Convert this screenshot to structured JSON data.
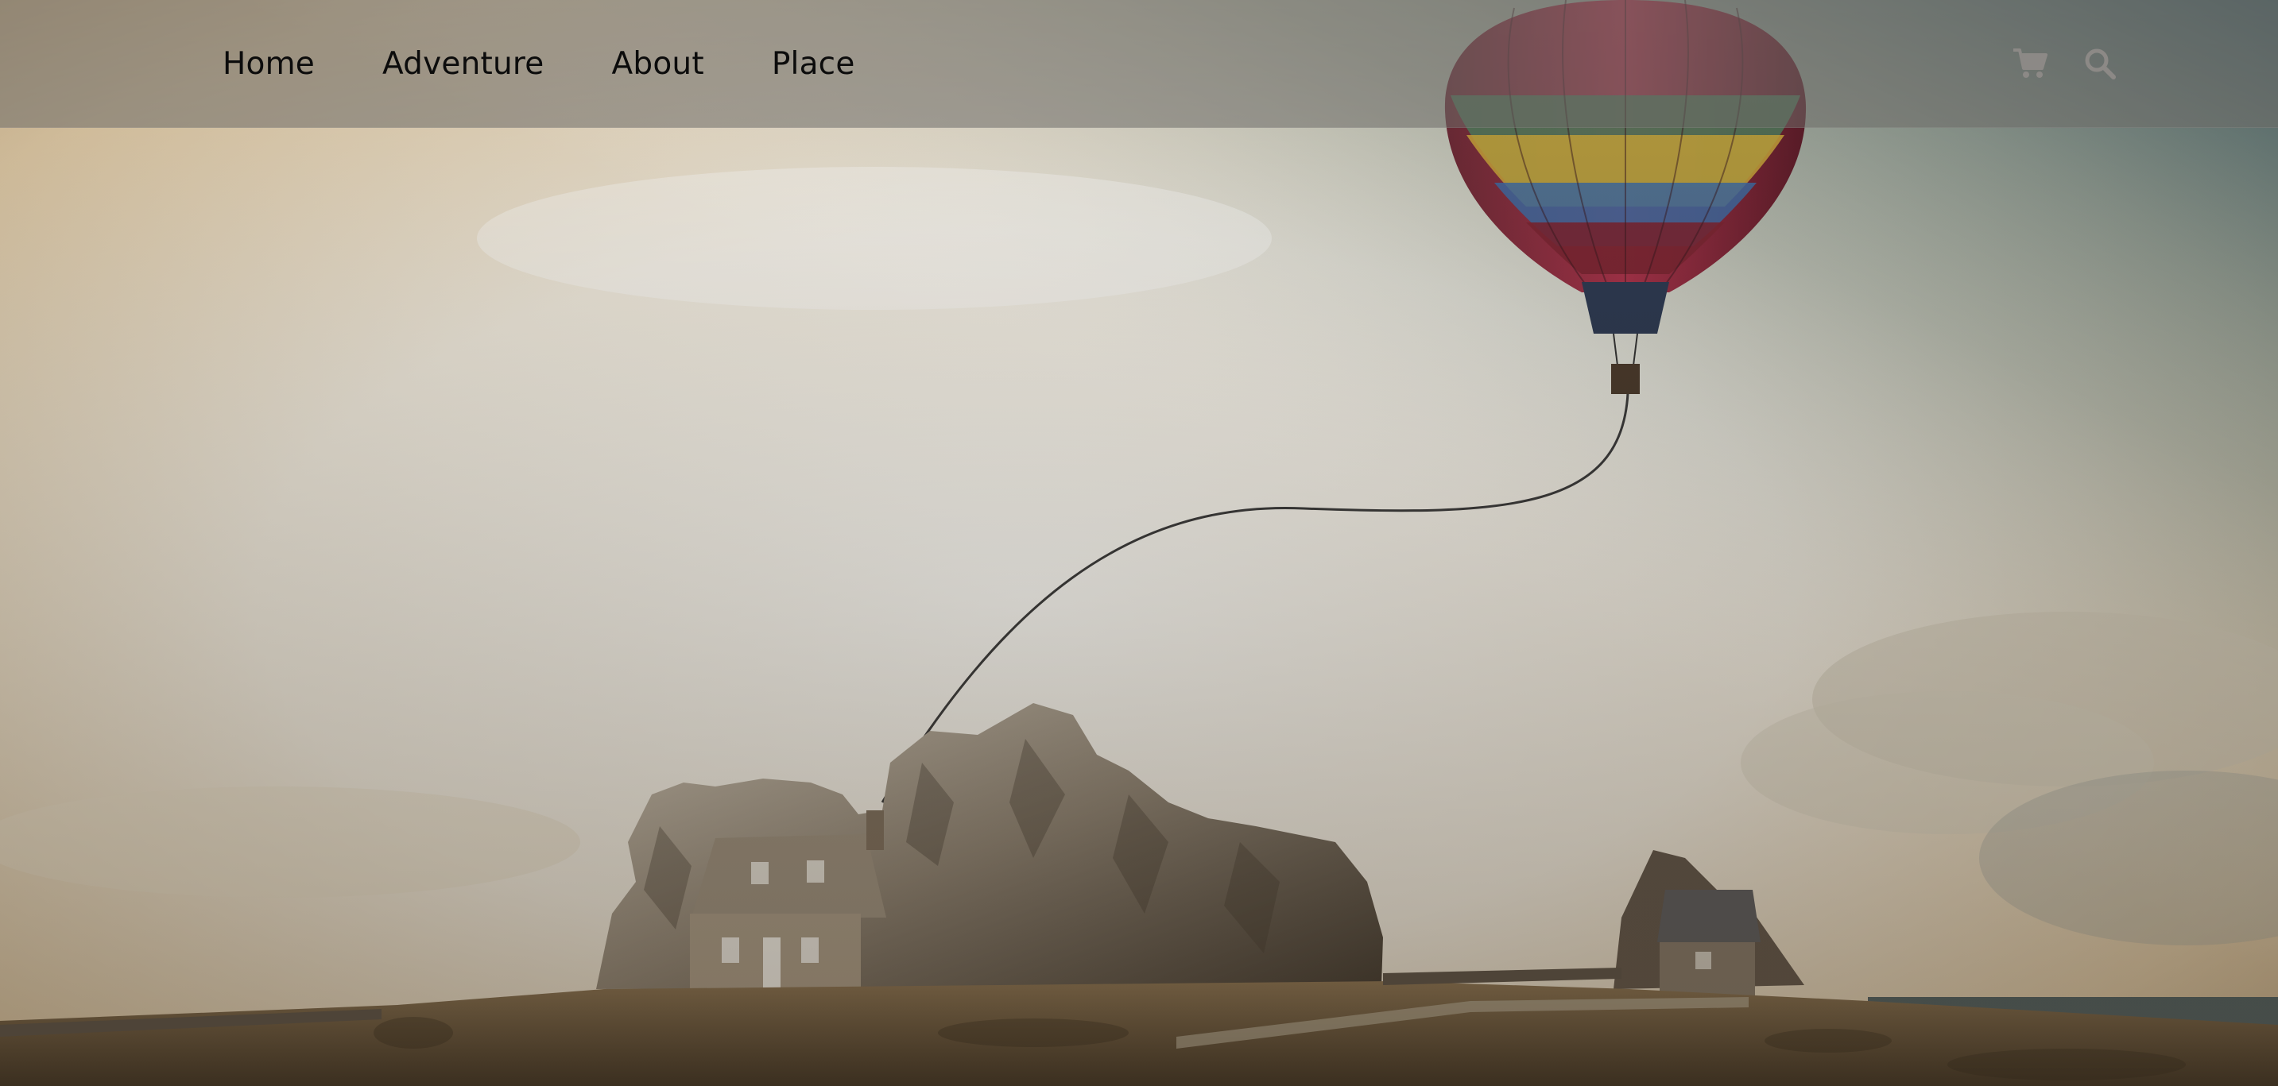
{
  "nav": {
    "links": [
      "Home",
      "Adventure",
      "About",
      "Place"
    ],
    "icons": [
      "cart-icon",
      "search-icon"
    ]
  },
  "hero": {
    "image": "hot-air-balloon-tethered-to-rock-house",
    "colors": {
      "sky_light": "#f3efe6",
      "sky_warm": "#e2cfae",
      "sky_teal": "#4f6f75",
      "rock": "#8c8276",
      "ground": "#6e5a3e"
    }
  }
}
